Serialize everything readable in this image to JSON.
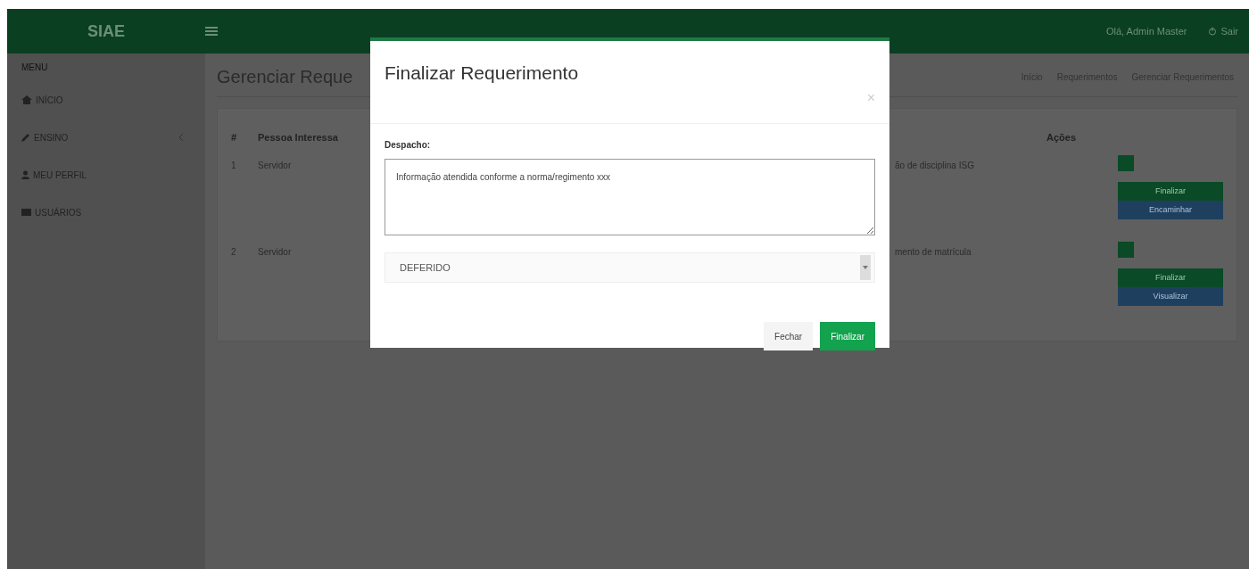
{
  "app": {
    "title": "SIAE"
  },
  "header": {
    "user": "Olá, Admin Master",
    "logout": "Sair"
  },
  "sidebar": {
    "heading": "MENU",
    "items": [
      {
        "label": "INÍCIO",
        "expandable": false
      },
      {
        "label": "ENSINO",
        "expandable": true
      },
      {
        "label": "MEU PERFIL",
        "expandable": false
      },
      {
        "label": "USUÁRIOS",
        "expandable": false
      }
    ]
  },
  "page": {
    "title": "Gerenciar Reque",
    "breadcrumb": [
      "Início",
      "Requerimentos",
      "Gerenciar Requerimentos"
    ]
  },
  "table": {
    "columns": [
      "#",
      "Pessoa Interessa",
      "Ações"
    ],
    "rows": [
      {
        "number": "1",
        "person": "Servidor",
        "description": "ão de disciplina ISG",
        "actions": [
          {
            "label": "Finalizar",
            "kind": "finish"
          },
          {
            "label": "Encaminhar",
            "kind": "forward"
          }
        ]
      },
      {
        "number": "2",
        "person": "Servidor",
        "description": "mento de matrícula",
        "actions": [
          {
            "label": "Finalizar",
            "kind": "finish"
          },
          {
            "label": "Visualizar",
            "kind": "forward"
          }
        ]
      }
    ]
  },
  "modal": {
    "title": "Finalizar Requerimento",
    "close": "×",
    "field_label": "Despacho:",
    "text": "Informação atendida conforme a norma/regimento xxx",
    "select": "DEFERIDO",
    "buttons": [
      {
        "label": "Fechar",
        "kind": "secondary"
      },
      {
        "label": "Finalizar",
        "kind": "primary"
      }
    ]
  }
}
